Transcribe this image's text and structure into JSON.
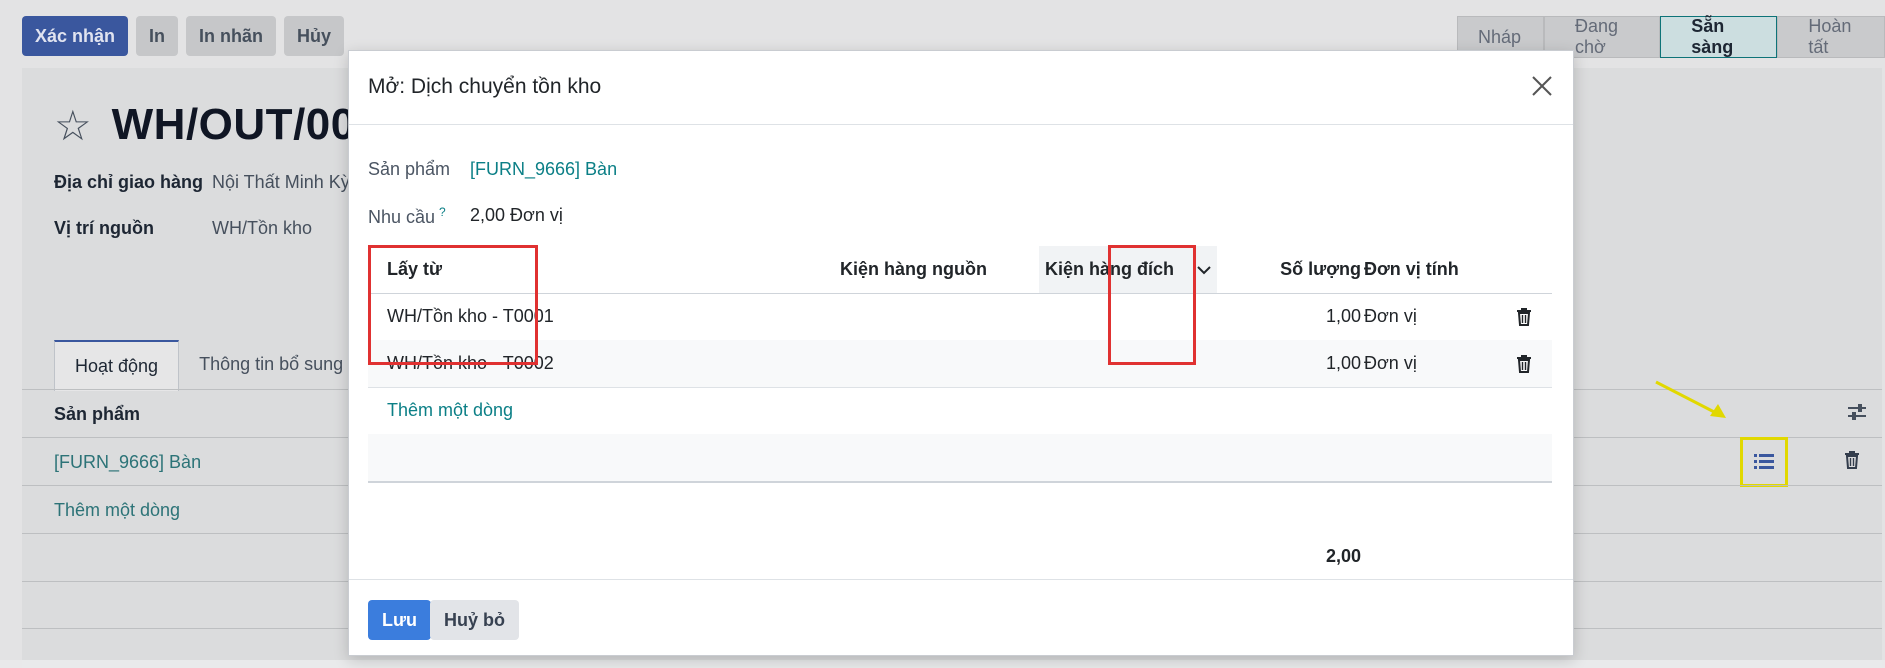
{
  "toolbar": {
    "confirm_label": "Xác nhận",
    "print_label": "In",
    "print_label_label": "In nhãn",
    "cancel_label": "Hủy"
  },
  "status_stages": [
    "Nháp",
    "Đang chờ",
    "Sẵn sàng",
    "Hoàn tất"
  ],
  "status_active": "Sẵn sàng",
  "record": {
    "title": "WH/OUT/00",
    "delivery_address_label": "Địa chỉ giao hàng",
    "delivery_address_value": "Nội Thất Minh Kỳ",
    "source_location_label": "Vị trí nguồn",
    "source_location_value": "WH/Tồn kho"
  },
  "tabs": [
    "Hoạt động",
    "Thông tin bổ sung"
  ],
  "operations": {
    "column_product": "Sản phẩm",
    "product": "[FURN_9666] Bàn",
    "add_line": "Thêm một dòng"
  },
  "modal": {
    "title": "Mở: Dịch chuyển tồn kho",
    "product_label": "Sản phẩm",
    "product_value": "[FURN_9666] Bàn",
    "demand_label": "Nhu cầu",
    "demand_help": "?",
    "demand_value": "2,00 Đơn vị",
    "columns": {
      "from": "Lấy từ",
      "source_package": "Kiện hàng nguồn",
      "dest_package": "Kiện hàng đích",
      "quantity": "Số lượng",
      "uom": "Đơn vị tính"
    },
    "lines": [
      {
        "from": "WH/Tồn kho - T0001",
        "quantity": "1,00",
        "uom": "Đơn vị"
      },
      {
        "from": "WH/Tồn kho - T0002",
        "quantity": "1,00",
        "uom": "Đơn vị"
      }
    ],
    "add_line": "Thêm một dòng",
    "total": "2,00",
    "save_label": "Lưu",
    "discard_label": "Huỷ bỏ"
  },
  "colors": {
    "primary": "#3e5da8",
    "teal": "#0b7f86",
    "annotation_red": "#e03131",
    "annotation_yellow": "#f0e600"
  }
}
